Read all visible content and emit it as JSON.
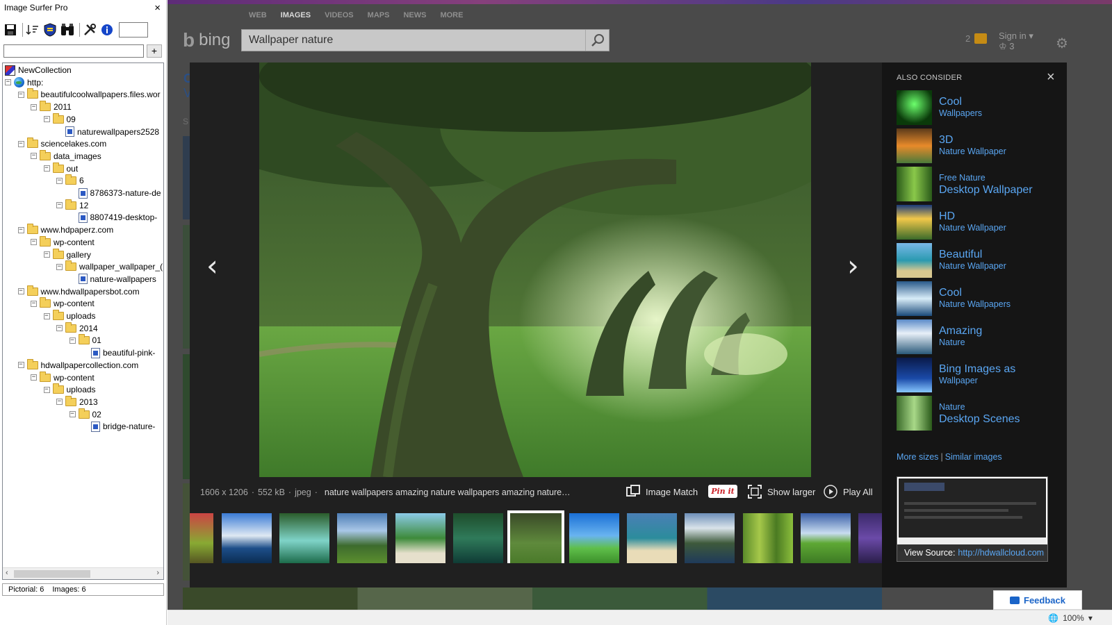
{
  "surfer": {
    "title": "Image Surfer Pro",
    "close_glyph": "×",
    "search_value": "",
    "add_glyph": "+",
    "tree": [
      {
        "label": "NewCollection",
        "icon": "collection-icon",
        "depth": 0,
        "toggle": ""
      },
      {
        "label": "http:",
        "icon": "globe-icon",
        "depth": 0,
        "toggle": "−"
      },
      {
        "label": "beautifulcoolwallpapers.files.wor",
        "icon": "folder-icon",
        "depth": 1,
        "toggle": "−"
      },
      {
        "label": "2011",
        "icon": "folder-icon",
        "depth": 2,
        "toggle": "−"
      },
      {
        "label": "09",
        "icon": "folder-icon",
        "depth": 3,
        "toggle": "−"
      },
      {
        "label": "naturewallpapers2528",
        "icon": "image-file-icon",
        "depth": 4,
        "toggle": ""
      },
      {
        "label": "sciencelakes.com",
        "icon": "folder-icon",
        "depth": 1,
        "toggle": "−"
      },
      {
        "label": "data_images",
        "icon": "folder-icon",
        "depth": 2,
        "toggle": "−"
      },
      {
        "label": "out",
        "icon": "folder-icon",
        "depth": 3,
        "toggle": "−"
      },
      {
        "label": "6",
        "icon": "folder-icon",
        "depth": 4,
        "toggle": "−"
      },
      {
        "label": "8786373-nature-de",
        "icon": "image-file-icon",
        "depth": 5,
        "toggle": ""
      },
      {
        "label": "12",
        "icon": "folder-icon",
        "depth": 4,
        "toggle": "−"
      },
      {
        "label": "8807419-desktop-",
        "icon": "image-file-icon",
        "depth": 5,
        "toggle": ""
      },
      {
        "label": "www.hdpaperz.com",
        "icon": "folder-icon",
        "depth": 1,
        "toggle": "−"
      },
      {
        "label": "wp-content",
        "icon": "folder-icon",
        "depth": 2,
        "toggle": "−"
      },
      {
        "label": "gallery",
        "icon": "folder-icon",
        "depth": 3,
        "toggle": "−"
      },
      {
        "label": "wallpaper_wallpaper_(",
        "icon": "folder-icon",
        "depth": 4,
        "toggle": "−"
      },
      {
        "label": "nature-wallpapers",
        "icon": "image-file-icon",
        "depth": 5,
        "toggle": ""
      },
      {
        "label": "www.hdwallpapersbot.com",
        "icon": "folder-icon",
        "depth": 1,
        "toggle": "−"
      },
      {
        "label": "wp-content",
        "icon": "folder-icon",
        "depth": 2,
        "toggle": "−"
      },
      {
        "label": "uploads",
        "icon": "folder-icon",
        "depth": 3,
        "toggle": "−"
      },
      {
        "label": "2014",
        "icon": "folder-icon",
        "depth": 4,
        "toggle": "−"
      },
      {
        "label": "01",
        "icon": "folder-icon",
        "depth": 5,
        "toggle": "−"
      },
      {
        "label": "beautiful-pink-",
        "icon": "image-file-icon",
        "depth": 6,
        "toggle": ""
      },
      {
        "label": "hdwallpapercollection.com",
        "icon": "folder-icon",
        "depth": 1,
        "toggle": "−"
      },
      {
        "label": "wp-content",
        "icon": "folder-icon",
        "depth": 2,
        "toggle": "−"
      },
      {
        "label": "uploads",
        "icon": "folder-icon",
        "depth": 3,
        "toggle": "−"
      },
      {
        "label": "2013",
        "icon": "folder-icon",
        "depth": 4,
        "toggle": "−"
      },
      {
        "label": "02",
        "icon": "folder-icon",
        "depth": 5,
        "toggle": "−"
      },
      {
        "label": "bridge-nature-",
        "icon": "image-file-icon",
        "depth": 6,
        "toggle": ""
      }
    ],
    "status": {
      "pictorial": "Pictorial: 6",
      "images": "Images: 6"
    }
  },
  "bing": {
    "nav": [
      "WEB",
      "IMAGES",
      "VIDEOS",
      "MAPS",
      "NEWS",
      "MORE"
    ],
    "nav_active": "IMAGES",
    "logo_text": "bing",
    "search_value": "Wallpaper nature",
    "notif_count": "2",
    "sign_in": "Sign in",
    "rewards": "3",
    "bg_title_1": "C",
    "bg_title_2": "V",
    "bg_letter": "S",
    "feedback": "Feedback"
  },
  "viewer": {
    "info": {
      "dims": "1606 x 1206",
      "size": "552 kB",
      "format": "jpeg",
      "desc": "nature wallpapers amazing nature wallpapers amazing nature…"
    },
    "actions": {
      "image_match": "Image Match",
      "pin_it": "Pin it",
      "show_larger": "Show larger",
      "play_all": "Play All"
    },
    "prev_glyph": "‹",
    "next_glyph": "›",
    "filmstrip_count": 13,
    "selected_index": 6,
    "also_consider_heading": "ALSO CONSIDER",
    "close_glyph": "×",
    "suggestions": [
      {
        "line1": "Cool",
        "line2": "Wallpapers",
        "line1_size": "big"
      },
      {
        "line1": "3D",
        "line2": "Nature Wallpaper",
        "line1_size": "big"
      },
      {
        "line1": "Free Nature",
        "line2": "Desktop Wallpaper",
        "line1_size": "small"
      },
      {
        "line1": "HD",
        "line2": "Nature Wallpaper",
        "line1_size": "big"
      },
      {
        "line1": "Beautiful",
        "line2": "Nature Wallpaper",
        "line1_size": "big"
      },
      {
        "line1": "Cool",
        "line2": "Nature Wallpapers",
        "line1_size": "big"
      },
      {
        "line1": "Amazing",
        "line2": "Nature",
        "line1_size": "big"
      },
      {
        "line1": "Bing Images as",
        "line2": "Wallpaper",
        "line1_size": "big"
      },
      {
        "line1": "Nature",
        "line2": "Desktop Scenes",
        "line1_size": "small"
      }
    ],
    "more_sizes": "More sizes",
    "similar_images": "Similar images",
    "view_source_label": "View Source:",
    "view_source_url": "http://hdwallcloud.com",
    "source_logo": "HD WALLCLOUD",
    "source_page_title": "Amazing Nature Wallpapers"
  },
  "zoom": "100%",
  "colors": {
    "accent": "#5aa6f2",
    "overlay_bg": "#202020",
    "sidebar_bg": "#151515"
  }
}
